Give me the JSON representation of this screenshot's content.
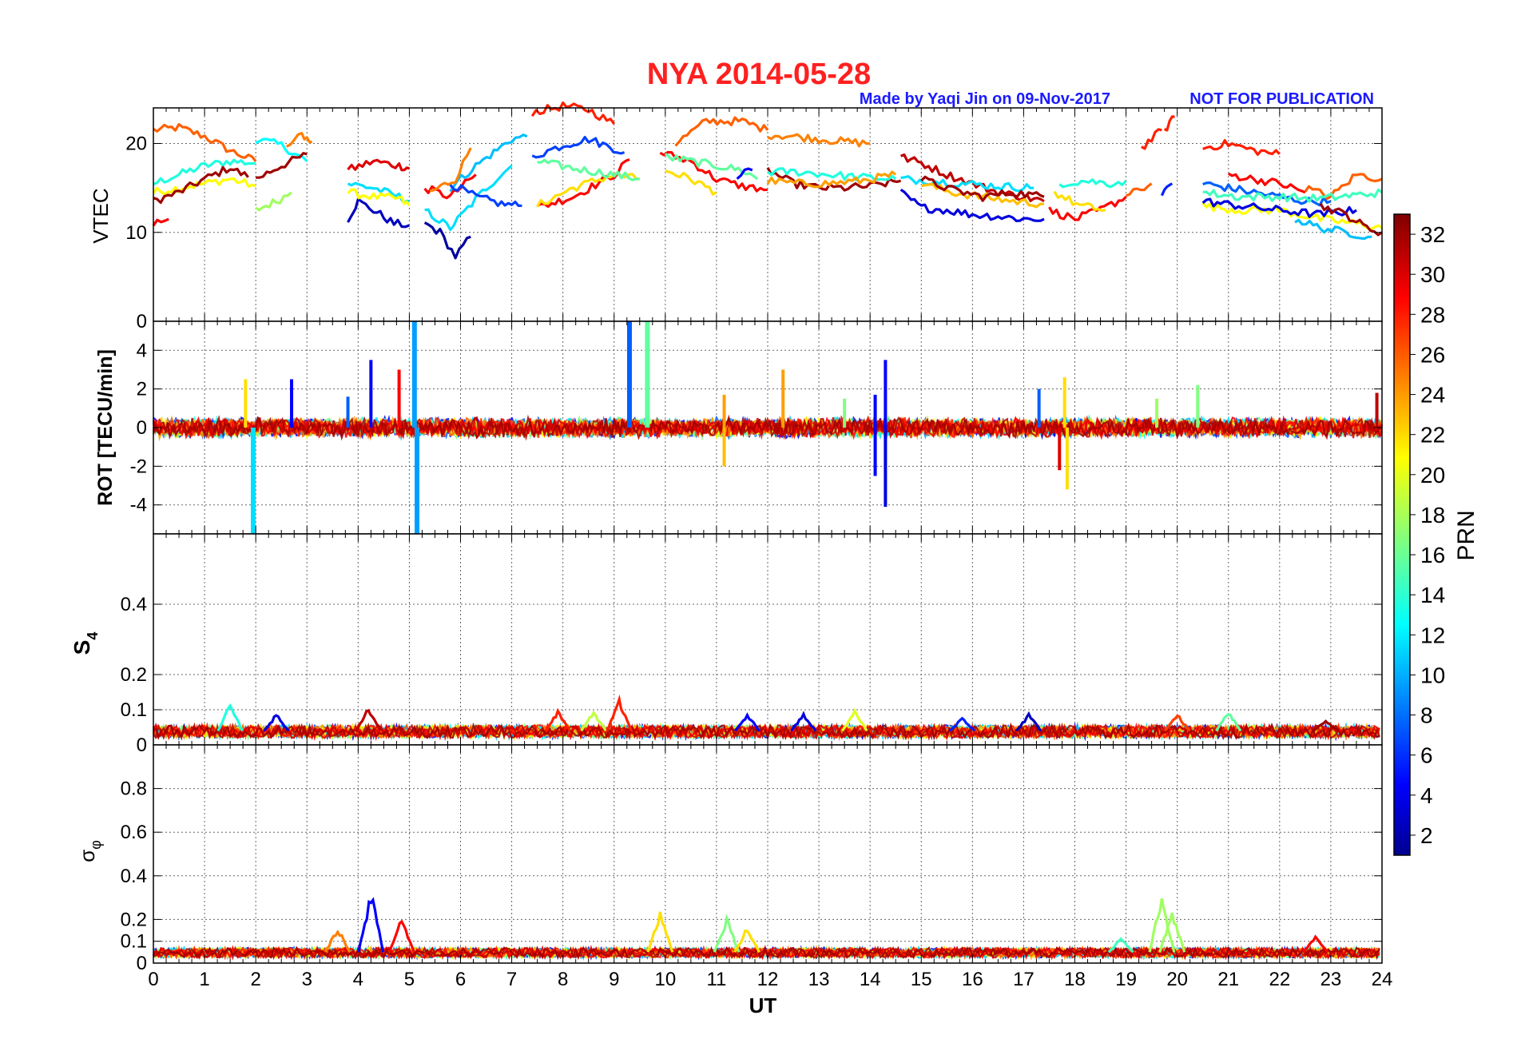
{
  "figure": {
    "title": "NYA   2014-05-28",
    "credit": "Made by Yaqi Jin on 09-Nov-2017",
    "notice": "NOT FOR PUBLICATION",
    "title_color": "#ff2020",
    "credit_color": "#1a1aff"
  },
  "chart_data": [
    {
      "type": "line",
      "panel": "vtec",
      "ylabel": "VTEC",
      "ylim": [
        0,
        24
      ],
      "yticks": [
        0,
        10,
        20
      ],
      "grid": true,
      "xlim": [
        0,
        24
      ],
      "traces": [
        {
          "prn": 26,
          "x": [
            0,
            0.5,
            1,
            1.5,
            2
          ],
          "y": [
            21.5,
            21.8,
            20.8,
            19.2,
            18.0
          ]
        },
        {
          "prn": 14,
          "x": [
            0,
            0.5,
            1,
            1.5,
            2
          ],
          "y": [
            15.5,
            16.5,
            17.5,
            18.0,
            17.8
          ]
        },
        {
          "prn": 21,
          "x": [
            0,
            0.5,
            1,
            1.5,
            2
          ],
          "y": [
            14.5,
            15.0,
            15.5,
            16.0,
            15.2
          ]
        },
        {
          "prn": 32,
          "x": [
            0,
            0.5,
            1,
            1.5,
            1.85
          ],
          "y": [
            13.5,
            14.5,
            16.0,
            17.3,
            16.2
          ]
        },
        {
          "prn": 29,
          "x": [
            0,
            0.3
          ],
          "y": [
            11.0,
            11.5
          ]
        },
        {
          "prn": 13,
          "x": [
            2,
            2.5,
            3
          ],
          "y": [
            20.5,
            19.8,
            18.0
          ]
        },
        {
          "prn": 25,
          "x": [
            2.6,
            2.9,
            3.1
          ],
          "y": [
            19.5,
            21.0,
            20.2
          ]
        },
        {
          "prn": 32,
          "x": [
            2,
            2.5,
            3
          ],
          "y": [
            16.0,
            17.5,
            18.8
          ]
        },
        {
          "prn": 18,
          "x": [
            2,
            2.4,
            2.7
          ],
          "y": [
            12.5,
            13.5,
            14.5
          ]
        },
        {
          "prn": 3,
          "x": [
            3.8,
            4,
            4.3,
            4.7,
            5
          ],
          "y": [
            11.5,
            13.5,
            12.5,
            11.0,
            10.8
          ]
        },
        {
          "prn": 30,
          "x": [
            3.8,
            4.3,
            4.8,
            5
          ],
          "y": [
            17.0,
            18.0,
            17.5,
            17.2
          ]
        },
        {
          "prn": 12,
          "x": [
            3.8,
            4.3,
            4.8,
            5
          ],
          "y": [
            15.5,
            15.0,
            14.0,
            13.5
          ]
        },
        {
          "prn": 21,
          "x": [
            3.8,
            4.3,
            4.8,
            5
          ],
          "y": [
            14.5,
            14.0,
            13.8,
            13.0
          ]
        },
        {
          "prn": 2,
          "x": [
            5.3,
            5.6,
            5.9,
            6.2
          ],
          "y": [
            11.0,
            10.0,
            7.3,
            9.5
          ]
        },
        {
          "prn": 12,
          "x": [
            5.3,
            5.8,
            6.5,
            7
          ],
          "y": [
            12.5,
            10.5,
            15.0,
            17.5
          ]
        },
        {
          "prn": 11,
          "x": [
            5.8,
            6.3,
            7,
            7.3
          ],
          "y": [
            15.0,
            17.5,
            20.5,
            20.8
          ]
        },
        {
          "prn": 29,
          "x": [
            5.3,
            5.8,
            6.3
          ],
          "y": [
            15.0,
            14.0,
            16.5
          ]
        },
        {
          "prn": 25,
          "x": [
            5.4,
            5.9,
            6.2
          ],
          "y": [
            14.5,
            16.0,
            19.5
          ]
        },
        {
          "prn": 7,
          "x": [
            5.8,
            6.3,
            6.8,
            7.2
          ],
          "y": [
            15.5,
            14.0,
            13.2,
            13.0
          ]
        },
        {
          "prn": 28,
          "x": [
            7.4,
            8,
            8.5,
            9
          ],
          "y": [
            23.5,
            24.2,
            23.8,
            22.2
          ]
        },
        {
          "prn": 7,
          "x": [
            7.4,
            8,
            8.5,
            9.2
          ],
          "y": [
            18.5,
            19.8,
            20.5,
            19.0
          ]
        },
        {
          "prn": 29,
          "x": [
            7.5,
            8.2,
            9,
            9.3
          ],
          "y": [
            12.8,
            14.0,
            16.5,
            18.2
          ]
        },
        {
          "prn": 22,
          "x": [
            7.5,
            8.2,
            9,
            9.5
          ],
          "y": [
            13.0,
            15.0,
            16.5,
            16.0
          ]
        },
        {
          "prn": 16,
          "x": [
            7.5,
            8.2,
            9,
            9.5
          ],
          "y": [
            18.0,
            17.2,
            16.5,
            16.0
          ]
        },
        {
          "prn": 26,
          "x": [
            10.2,
            10.8,
            11.5,
            12
          ],
          "y": [
            20.0,
            22.5,
            22.5,
            21.5
          ]
        },
        {
          "prn": 25,
          "x": [
            12,
            12.5,
            13,
            13.5,
            14
          ],
          "y": [
            21.0,
            20.8,
            20.5,
            20.2,
            20.0
          ]
        },
        {
          "prn": 29,
          "x": [
            9.9,
            10.5,
            11,
            11.5,
            12
          ],
          "y": [
            19.0,
            18.0,
            16.0,
            15.2,
            14.8
          ]
        },
        {
          "prn": 16,
          "x": [
            10,
            10.5,
            11,
            11.5,
            11.8
          ],
          "y": [
            18.5,
            18.0,
            17.5,
            17.0,
            16.0
          ]
        },
        {
          "prn": 22,
          "x": [
            10,
            10.5,
            11
          ],
          "y": [
            17.0,
            16.0,
            14.5
          ]
        },
        {
          "prn": 5,
          "x": [
            11.4,
            11.7
          ],
          "y": [
            16.2,
            17.0
          ]
        },
        {
          "prn": 32,
          "x": [
            12,
            12.5,
            13,
            13.5,
            14,
            14.6
          ],
          "y": [
            17.0,
            15.5,
            15.0,
            15.0,
            15.2,
            15.8
          ]
        },
        {
          "prn": 14,
          "x": [
            12,
            12.6,
            13.2,
            13.8,
            14.5
          ],
          "y": [
            16.8,
            16.8,
            16.5,
            16.2,
            16.0
          ]
        },
        {
          "prn": 24,
          "x": [
            12,
            12.6,
            13.2,
            13.8,
            14.5
          ],
          "y": [
            15.8,
            15.5,
            15.5,
            15.8,
            16.5
          ]
        },
        {
          "prn": 4,
          "x": [
            14.6,
            15,
            15.5,
            16,
            16.5,
            17,
            17.4
          ],
          "y": [
            14.5,
            12.8,
            12.5,
            12.0,
            11.8,
            11.5,
            11.5
          ]
        },
        {
          "prn": 31,
          "x": [
            14.6,
            15,
            15.5,
            16,
            16.5,
            17,
            17.4
          ],
          "y": [
            18.5,
            17.8,
            16.5,
            15.5,
            14.5,
            14.0,
            13.5
          ]
        },
        {
          "prn": 12,
          "x": [
            14.6,
            15.2,
            15.8,
            16.5,
            17.2
          ],
          "y": [
            16.0,
            15.8,
            15.5,
            15.2,
            15.0
          ]
        },
        {
          "prn": 23,
          "x": [
            15,
            15.6,
            16.2,
            16.8,
            17.4
          ],
          "y": [
            15.5,
            14.5,
            14.0,
            13.5,
            13.2
          ]
        },
        {
          "prn": 32,
          "x": [
            15,
            15.6,
            16.2,
            16.8,
            17.4
          ],
          "y": [
            16.0,
            14.8,
            14.0,
            14.5,
            14.0
          ]
        },
        {
          "prn": 14,
          "x": [
            17.7,
            18.2,
            18.7,
            19
          ],
          "y": [
            15.5,
            15.8,
            15.5,
            15.8
          ]
        },
        {
          "prn": 29,
          "x": [
            17.5,
            18,
            18.5,
            19
          ],
          "y": [
            12.5,
            11.5,
            12.5,
            14.0
          ]
        },
        {
          "prn": 22,
          "x": [
            17.6,
            18.1,
            18.6
          ],
          "y": [
            14.5,
            13.0,
            12.5
          ]
        },
        {
          "prn": 26,
          "x": [
            19,
            19.5
          ],
          "y": [
            14.0,
            15.5
          ]
        },
        {
          "prn": 28,
          "x": [
            19.3,
            19.7
          ],
          "y": [
            19.5,
            21.5
          ]
        },
        {
          "prn": 28,
          "x": [
            19.75,
            19.95
          ],
          "y": [
            21.5,
            23.0
          ]
        },
        {
          "prn": 6,
          "x": [
            19.7,
            19.9
          ],
          "y": [
            14.5,
            15.5
          ]
        },
        {
          "prn": 28,
          "x": [
            20.5,
            21,
            21.5,
            22
          ],
          "y": [
            19.5,
            20.0,
            19.2,
            18.8
          ]
        },
        {
          "prn": 29,
          "x": [
            21,
            21.5,
            22,
            22.5
          ],
          "y": [
            16.5,
            16.0,
            15.5,
            14.5
          ]
        },
        {
          "prn": 8,
          "x": [
            20.5,
            21,
            21.5,
            22,
            22.5,
            23
          ],
          "y": [
            15.5,
            15.0,
            14.5,
            14.0,
            13.5,
            13.5
          ]
        },
        {
          "prn": 26,
          "x": [
            22.5,
            23,
            23.5,
            24
          ],
          "y": [
            15.0,
            14.0,
            16.5,
            16.0
          ]
        },
        {
          "prn": 21,
          "x": [
            20.5,
            21.2,
            22,
            22.8,
            23.5,
            24
          ],
          "y": [
            13.0,
            12.5,
            12.5,
            11.5,
            11.0,
            10.5
          ]
        },
        {
          "prn": 4,
          "x": [
            20.5,
            21.2,
            22,
            22.8,
            23.5
          ],
          "y": [
            13.5,
            13.0,
            12.5,
            12.0,
            12.5
          ]
        },
        {
          "prn": 11,
          "x": [
            22.3,
            22.8,
            23.3,
            23.8
          ],
          "y": [
            11.5,
            10.5,
            10.0,
            9.5
          ]
        },
        {
          "prn": 32,
          "x": [
            22.8,
            23.3,
            23.7,
            24
          ],
          "y": [
            13.0,
            12.0,
            10.5,
            10.0
          ]
        },
        {
          "prn": 15,
          "x": [
            20.5,
            21.2,
            22,
            22.8,
            23.5,
            24
          ],
          "y": [
            14.5,
            14.0,
            14.0,
            13.8,
            14.2,
            14.5
          ]
        }
      ]
    },
    {
      "type": "line",
      "panel": "rot",
      "ylabel": "ROT [TECU/min]",
      "ylim": [
        -5.5,
        5.5
      ],
      "yticks": [
        -4,
        -2,
        0,
        2,
        4
      ],
      "grid": true,
      "xlim": [
        0,
        24
      ],
      "noise_amplitude": 0.5,
      "spikes": [
        {
          "x": 1.8,
          "y": 2.5,
          "prn": 22
        },
        {
          "x": 1.95,
          "y": -5.5,
          "prn": 12
        },
        {
          "x": 2.7,
          "y": 2.5,
          "prn": 5
        },
        {
          "x": 3.8,
          "y": 1.6,
          "prn": 8
        },
        {
          "x": 4.25,
          "y": 3.5,
          "prn": 5
        },
        {
          "x": 4.8,
          "y": 3.0,
          "prn": 29
        },
        {
          "x": 5.1,
          "y": 5.5,
          "prn": 10
        },
        {
          "x": 5.15,
          "y": -5.5,
          "prn": 10
        },
        {
          "x": 9.3,
          "y": 5.5,
          "prn": 8
        },
        {
          "x": 9.65,
          "y": 5.5,
          "prn": 16
        },
        {
          "x": 11.15,
          "y": 1.7,
          "prn": 24
        },
        {
          "x": 11.15,
          "y": -2.0,
          "prn": 23
        },
        {
          "x": 12.3,
          "y": 3.0,
          "prn": 24
        },
        {
          "x": 13.5,
          "y": 1.5,
          "prn": 17
        },
        {
          "x": 14.1,
          "y": 1.7,
          "prn": 5
        },
        {
          "x": 14.1,
          "y": -2.5,
          "prn": 5
        },
        {
          "x": 14.3,
          "y": 3.5,
          "prn": 5
        },
        {
          "x": 14.3,
          "y": -4.1,
          "prn": 4
        },
        {
          "x": 17.3,
          "y": 2.0,
          "prn": 8
        },
        {
          "x": 17.7,
          "y": -2.2,
          "prn": 30
        },
        {
          "x": 17.8,
          "y": 2.6,
          "prn": 22
        },
        {
          "x": 17.85,
          "y": -3.2,
          "prn": 22
        },
        {
          "x": 19.6,
          "y": 1.5,
          "prn": 18
        },
        {
          "x": 20.4,
          "y": 2.2,
          "prn": 17
        },
        {
          "x": 23.9,
          "y": 1.8,
          "prn": 31
        }
      ]
    },
    {
      "type": "line",
      "panel": "s4",
      "ylabel": "S4",
      "ylim": [
        0,
        0.6
      ],
      "yticks": [
        0,
        0.1,
        0.2,
        0.4
      ],
      "grid": true,
      "xlim": [
        0,
        24
      ],
      "baseline": 0.04,
      "bursts": [
        {
          "x": 1.5,
          "y": 0.12,
          "prn": 14
        },
        {
          "x": 2.4,
          "y": 0.09,
          "prn": 4
        },
        {
          "x": 4.2,
          "y": 0.11,
          "prn": 31
        },
        {
          "x": 7.9,
          "y": 0.1,
          "prn": 28
        },
        {
          "x": 8.6,
          "y": 0.1,
          "prn": 19
        },
        {
          "x": 9.1,
          "y": 0.13,
          "prn": 28
        },
        {
          "x": 11.6,
          "y": 0.09,
          "prn": 5
        },
        {
          "x": 12.7,
          "y": 0.09,
          "prn": 4
        },
        {
          "x": 13.7,
          "y": 0.1,
          "prn": 20
        },
        {
          "x": 15.8,
          "y": 0.08,
          "prn": 6
        },
        {
          "x": 17.1,
          "y": 0.09,
          "prn": 3
        },
        {
          "x": 20.0,
          "y": 0.09,
          "prn": 27
        },
        {
          "x": 21.0,
          "y": 0.1,
          "prn": 16
        },
        {
          "x": 22.9,
          "y": 0.07,
          "prn": 32
        }
      ]
    },
    {
      "type": "line",
      "panel": "sigphi",
      "ylabel": "σφ",
      "ylim": [
        0,
        1.0
      ],
      "yticks": [
        0,
        0.1,
        0.2,
        0.4,
        0.6,
        0.8
      ],
      "grid": true,
      "xlim": [
        0,
        24
      ],
      "baseline": 0.05,
      "bursts": [
        {
          "x": 3.6,
          "y": 0.17,
          "prn": 25
        },
        {
          "x": 4.25,
          "y": 0.35,
          "prn": 5
        },
        {
          "x": 4.85,
          "y": 0.22,
          "prn": 29
        },
        {
          "x": 9.9,
          "y": 0.25,
          "prn": 22
        },
        {
          "x": 11.2,
          "y": 0.22,
          "prn": 17
        },
        {
          "x": 11.6,
          "y": 0.17,
          "prn": 22
        },
        {
          "x": 18.9,
          "y": 0.12,
          "prn": 15
        },
        {
          "x": 19.7,
          "y": 0.33,
          "prn": 18
        },
        {
          "x": 19.9,
          "y": 0.25,
          "prn": 18
        },
        {
          "x": 22.7,
          "y": 0.13,
          "prn": 29
        }
      ]
    }
  ],
  "xaxis": {
    "label": "UT",
    "ticks": [
      0,
      1,
      2,
      3,
      4,
      5,
      6,
      7,
      8,
      9,
      10,
      11,
      12,
      13,
      14,
      15,
      16,
      17,
      18,
      19,
      20,
      21,
      22,
      23,
      24
    ]
  },
  "colorbar": {
    "label": "PRN",
    "range": [
      1,
      33
    ],
    "ticks": [
      2,
      4,
      6,
      8,
      10,
      12,
      14,
      16,
      18,
      20,
      22,
      24,
      26,
      28,
      30,
      32
    ],
    "colormap": "jet"
  },
  "s4_label": {
    "main": "S",
    "sub": "4"
  },
  "sigphi_label": {
    "main": "σ",
    "sub": "φ"
  }
}
